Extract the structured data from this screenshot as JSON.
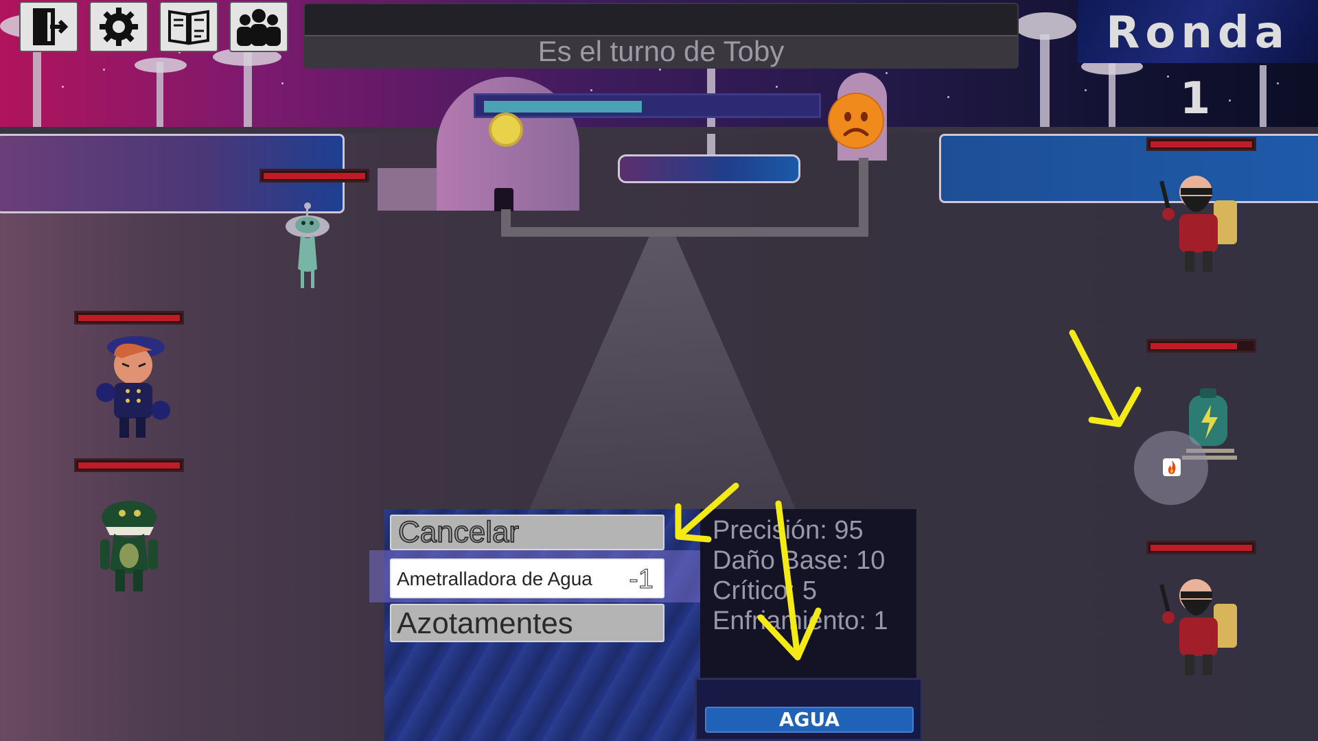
{
  "top_buttons": [
    {
      "name": "exit-button",
      "icon": "exit-door-icon"
    },
    {
      "name": "settings-button",
      "icon": "gear-icon"
    },
    {
      "name": "journal-button",
      "icon": "book-icon"
    },
    {
      "name": "party-button",
      "icon": "group-icon"
    }
  ],
  "turn": {
    "text": "Es el turno de Toby"
  },
  "round": {
    "label": "Ronda 1"
  },
  "mood": {
    "icon": "sad-face-icon",
    "color": "#f08a1c"
  },
  "progress": {
    "fraction": 0.48
  },
  "status_effect": {
    "icon": "fire-icon"
  },
  "menu": {
    "cancel_label": "Cancelar",
    "skills": [
      {
        "label": "Ametralladora de Agua",
        "cost": "-1",
        "selected": true
      },
      {
        "label": "Azotamentes",
        "cost": "",
        "selected": false
      }
    ]
  },
  "skill_info": {
    "precision": "Precisión: 95",
    "damage": "Daño Base: 10",
    "critical": "Crítico: 5",
    "cooldown": "Enfriamiento: 1",
    "type": "AGUA",
    "type_color": "#1f62b8"
  },
  "units": {
    "allies": [
      {
        "name": "ghost-alien",
        "health": 1.0
      },
      {
        "name": "officer-toby",
        "health": 1.0
      },
      {
        "name": "green-monster",
        "health": 1.0
      }
    ],
    "enemies": [
      {
        "name": "bearded-soldier-top",
        "health": 1.0
      },
      {
        "name": "energy-tank",
        "health": 0.85
      },
      {
        "name": "bearded-soldier-bottom",
        "health": 1.0
      }
    ]
  },
  "colors": {
    "health": "#c01c28",
    "highlight_arrows": "#f4ea16"
  }
}
